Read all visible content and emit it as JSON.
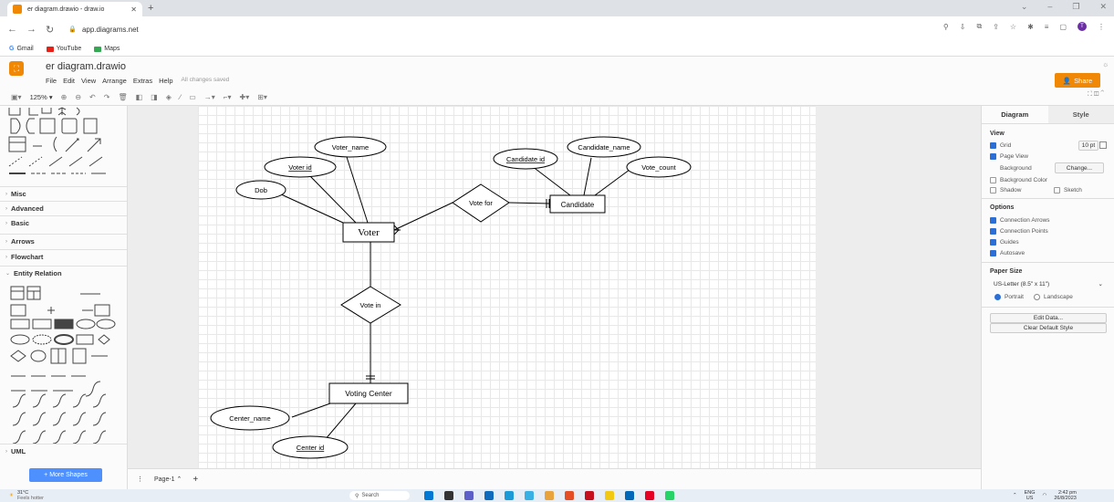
{
  "browser": {
    "tab_title": "er diagram.drawio - draw.io",
    "url": "app.diagrams.net",
    "bookmarks": [
      "Gmail",
      "YouTube",
      "Maps"
    ],
    "avatar_letter": "T"
  },
  "app": {
    "title": "er diagram.drawio",
    "menus": [
      "File",
      "Edit",
      "View",
      "Arrange",
      "Extras",
      "Help"
    ],
    "saved_status": "All changes saved",
    "share_label": "Share",
    "zoom": "125%",
    "accent": "#f08705"
  },
  "sidebar": {
    "sections": [
      "Misc",
      "Advanced",
      "Basic",
      "Arrows",
      "Flowchart",
      "Entity Relation",
      "UML"
    ],
    "more_shapes": "+ More Shapes"
  },
  "diagram": {
    "entities": {
      "voter": "Voter",
      "candidate": "Candidate",
      "voting_center": "Voting Center"
    },
    "attributes": {
      "voter_name": "Voter_name",
      "voter_id": "Voter id",
      "dob": "Dob",
      "candidate_id": "Candidate id",
      "candidate_name": "Candidate_name",
      "vote_count": "Vote_count",
      "center_name": "Center_name",
      "center_id": "Center id"
    },
    "relationships": {
      "vote_for": "Vote for",
      "vote_in": "Vote in"
    }
  },
  "pages": {
    "current": "Page-1",
    "add": "+"
  },
  "format_panel": {
    "tabs": [
      "Diagram",
      "Style"
    ],
    "view_heading": "View",
    "grid": "Grid",
    "grid_size": "10 pt",
    "page_view": "Page View",
    "background": "Background",
    "change": "Change...",
    "background_color": "Background Color",
    "shadow": "Shadow",
    "sketch": "Sketch",
    "options_heading": "Options",
    "options": [
      "Connection Arrows",
      "Connection Points",
      "Guides",
      "Autosave"
    ],
    "paper_heading": "Paper Size",
    "paper_size": "US-Letter (8.5\" x 11\")",
    "portrait": "Portrait",
    "landscape": "Landscape",
    "edit_data": "Edit Data...",
    "clear_style": "Clear Default Style"
  },
  "taskbar": {
    "temp": "31°C",
    "weather": "Feels hotter",
    "search": "Search",
    "lang": "ENG",
    "region": "US",
    "time": "2:42 pm",
    "date": "26/8/2023"
  }
}
